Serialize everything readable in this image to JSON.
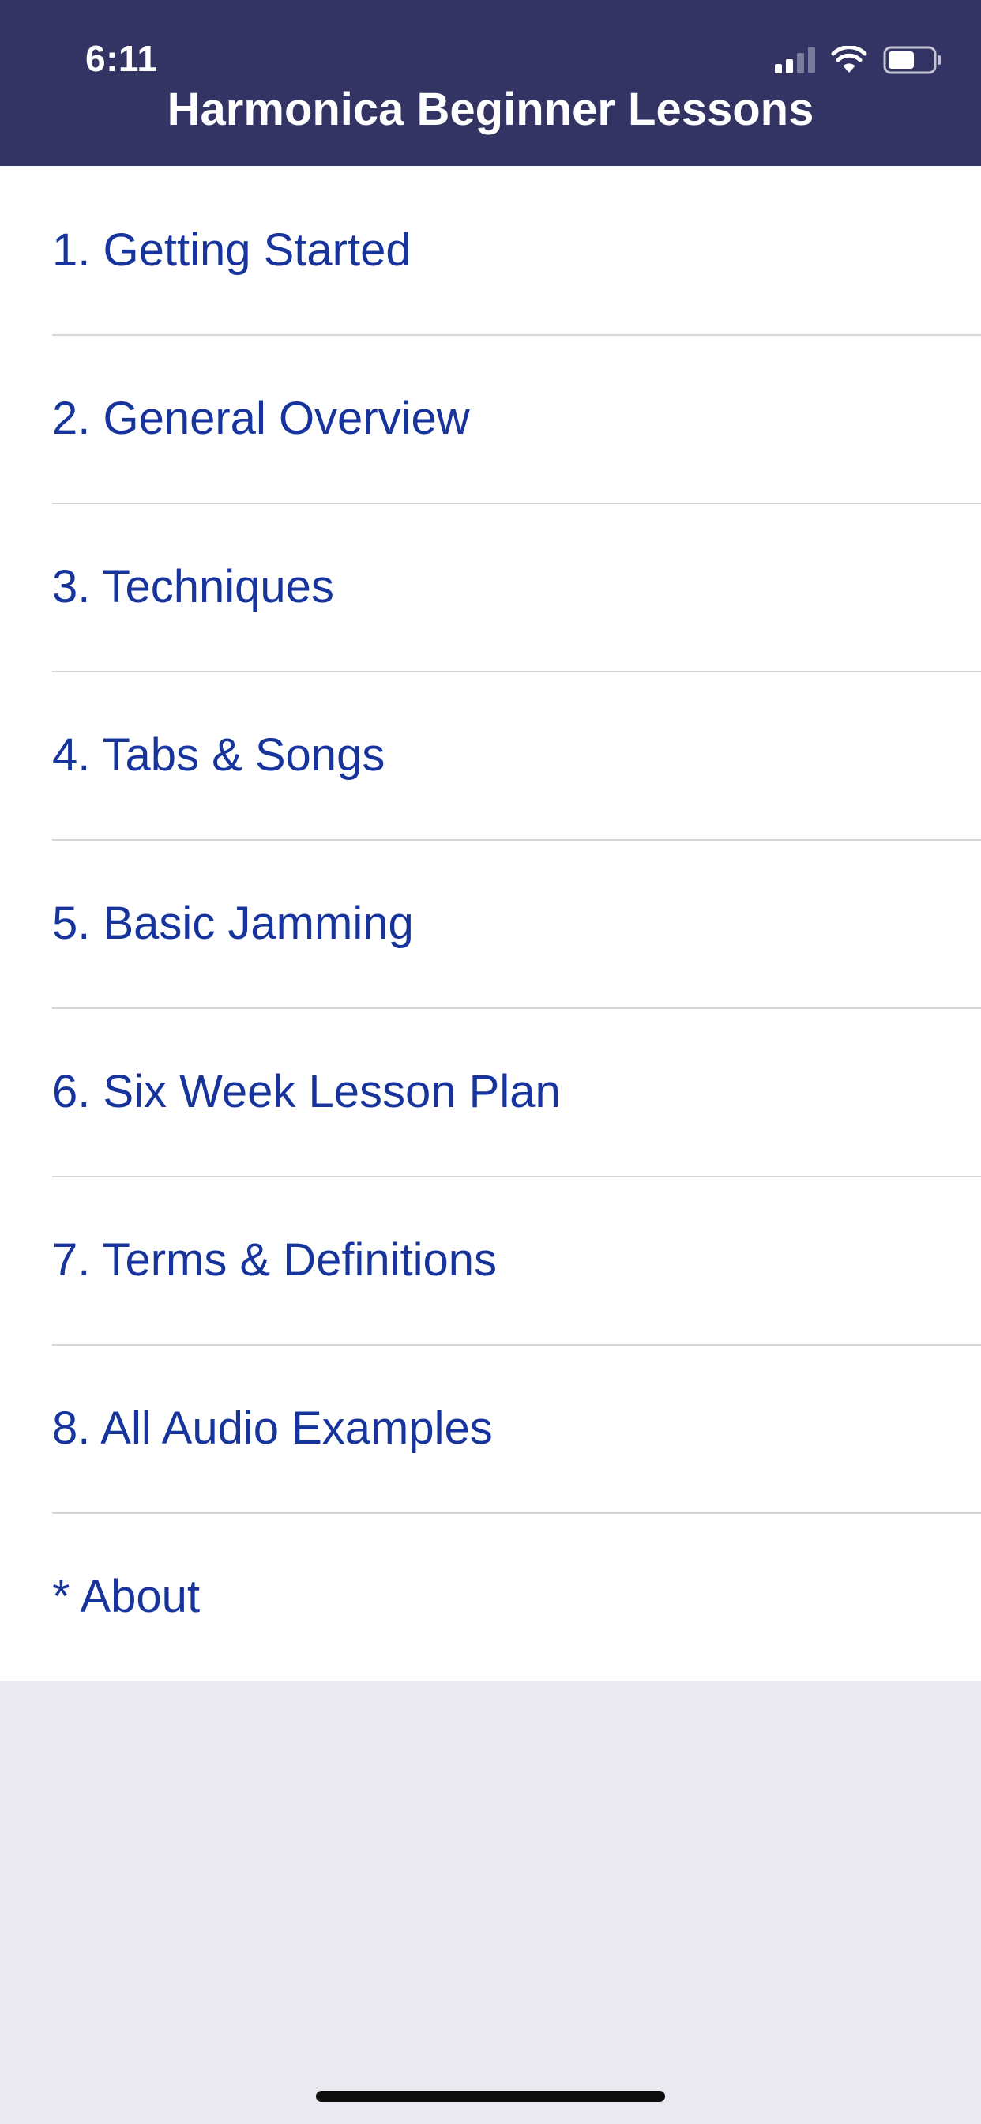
{
  "status_bar": {
    "time": "6:11",
    "icons": [
      "cellular-signal-icon",
      "wifi-icon",
      "battery-icon"
    ]
  },
  "navigation": {
    "title": "Harmonica Beginner Lessons"
  },
  "menu": {
    "items": [
      {
        "label": "1. Getting Started"
      },
      {
        "label": "2. General Overview"
      },
      {
        "label": "3. Techniques"
      },
      {
        "label": "4. Tabs & Songs"
      },
      {
        "label": "5. Basic Jamming"
      },
      {
        "label": "6. Six Week Lesson Plan"
      },
      {
        "label": "7. Terms & Definitions"
      },
      {
        "label": "8. All Audio Examples"
      },
      {
        "label": "* About"
      }
    ]
  },
  "colors": {
    "header_background": "#333463",
    "header_text": "#ffffff",
    "item_text": "#17349c",
    "list_background": "#ffffff",
    "page_background": "#e9e9ef",
    "separator": "#d6d6da"
  }
}
